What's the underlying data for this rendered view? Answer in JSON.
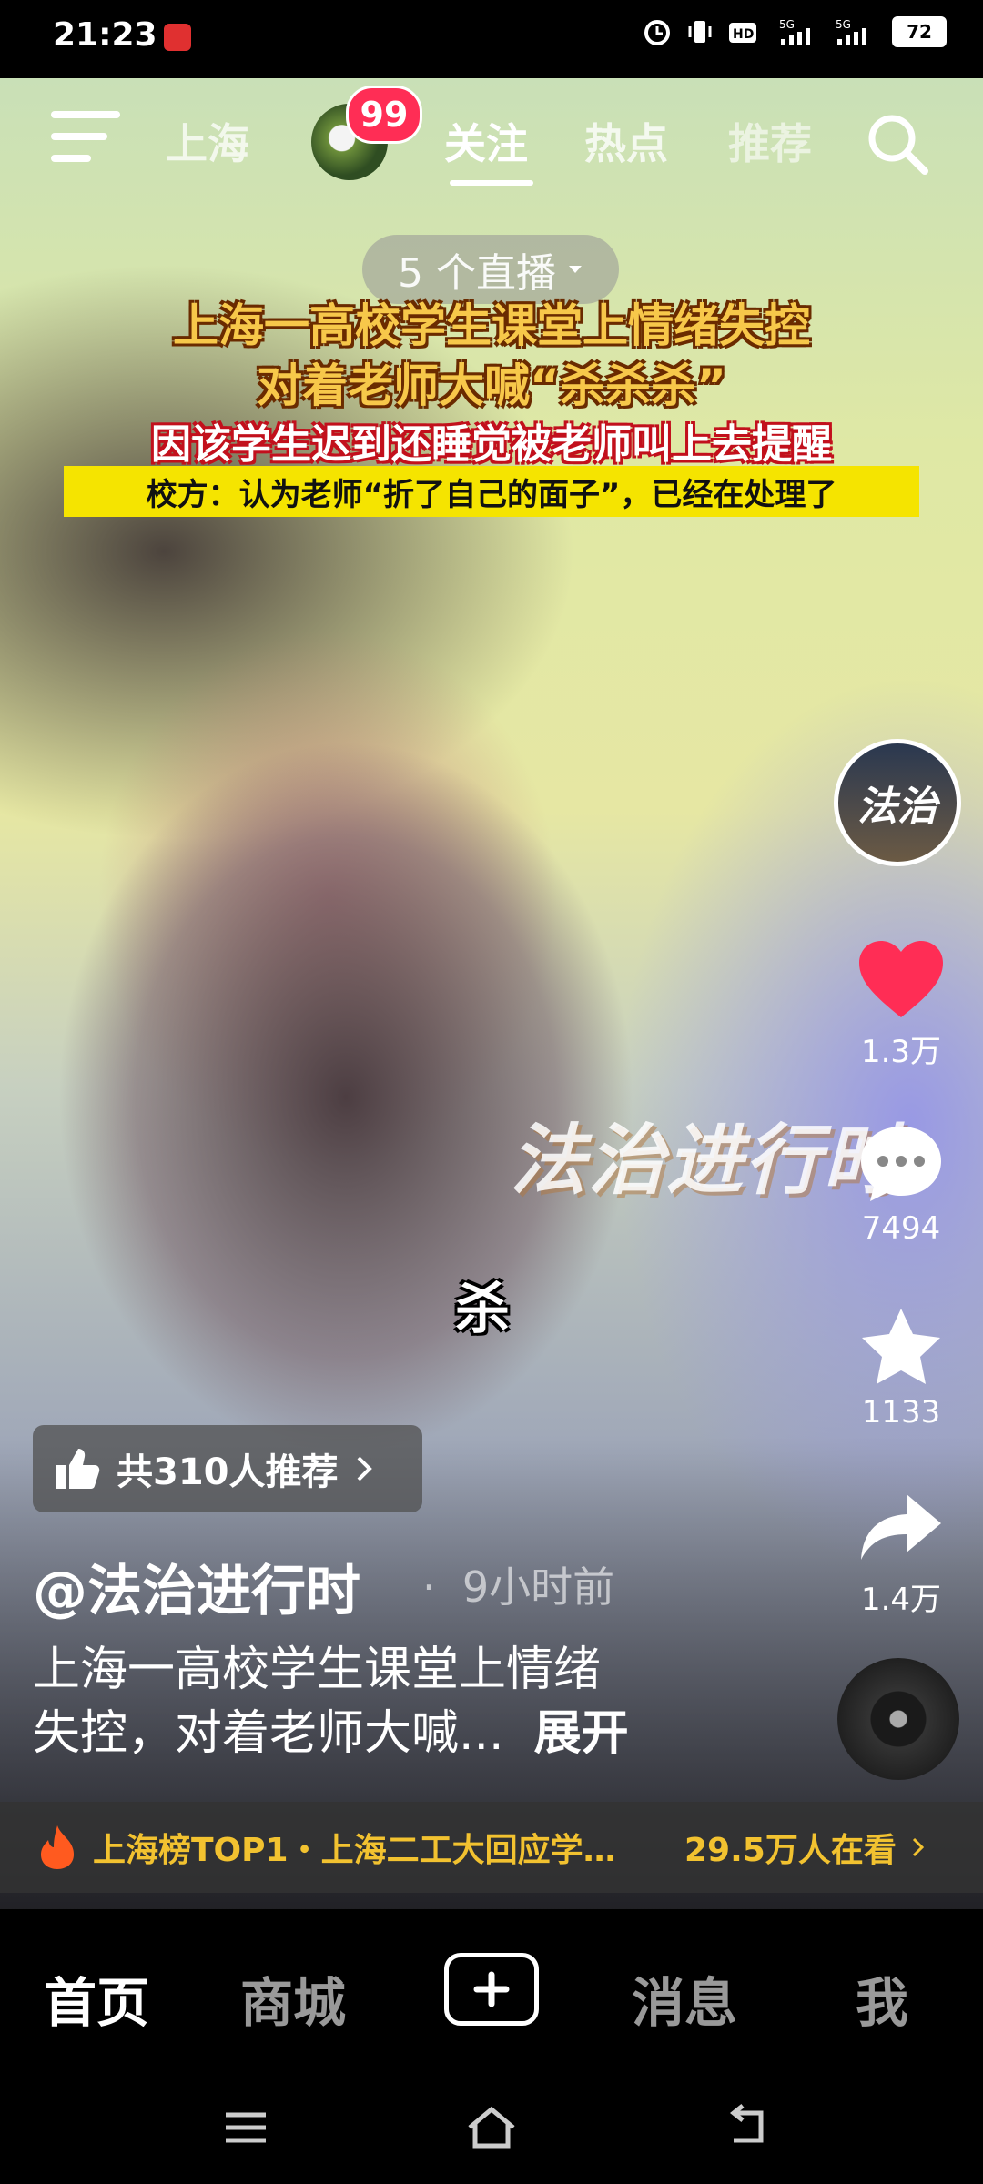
{
  "status": {
    "time": "21:23",
    "battery": "72"
  },
  "topnav": {
    "city": "上海",
    "badge": "99",
    "tabs": [
      {
        "label": "关注",
        "active": true
      },
      {
        "label": "热点"
      },
      {
        "label": "推荐"
      }
    ]
  },
  "video": {
    "live_label": "5 个直播",
    "headline_line1": "上海一高校学生课堂上情绪失控",
    "headline_line2": "对着老师大喊“杀杀杀”",
    "headline_line3": "因该学生迟到还睡觉被老师叫上去提醒",
    "headline_line4": "校方：认为老师“折了自己的面子”，已经在处理了",
    "watermark": "法治进行时",
    "subtitle": "杀"
  },
  "side": {
    "avatar_text": "法治",
    "likes": "1.3万",
    "comments": "7494",
    "favorites": "1133",
    "shares": "1.4万"
  },
  "post": {
    "recommend": "共310人推荐",
    "author": "@法治进行时",
    "time": "9小时前",
    "desc_line1": "上海一高校学生课堂上情绪",
    "desc_line2": "失控，对着老师大喊...",
    "expand": "展开"
  },
  "trend": {
    "text": "上海榜TOP1・上海二工大回应学…",
    "count": "29.5万人在看"
  },
  "bottomnav": {
    "home": "首页",
    "mall": "商城",
    "messages": "消息",
    "me": "我"
  },
  "colors": {
    "like": "#ff2d55",
    "trend": "#f2c230",
    "badge": "#ff2d55",
    "headline": "#f7c84a",
    "banner": "#f5e400"
  }
}
